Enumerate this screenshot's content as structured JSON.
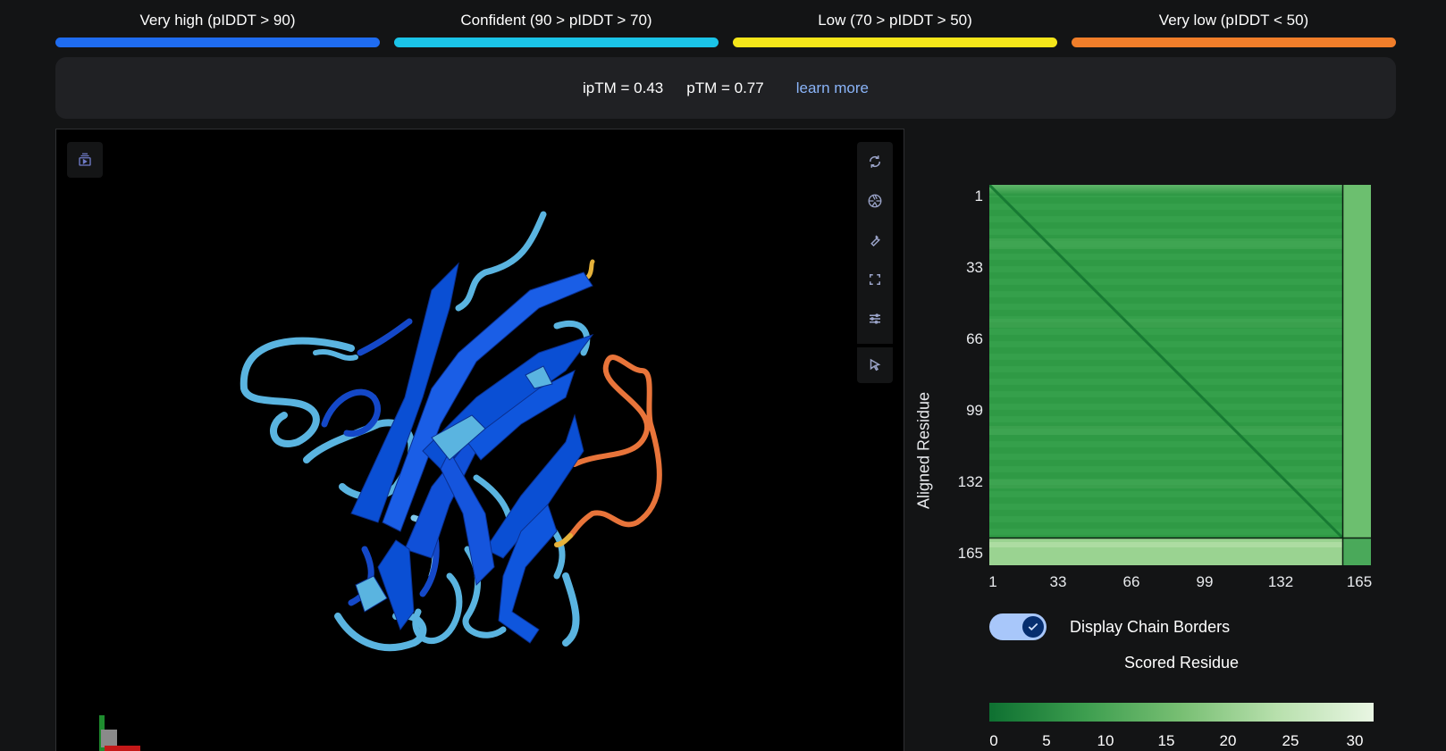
{
  "legend": [
    {
      "label": "Very high (pIDDT > 90)",
      "color": "#1f6cf0"
    },
    {
      "label": "Confident (90 > pIDDT > 70)",
      "color": "#1bc4e8"
    },
    {
      "label": "Low (70 > pIDDT > 50)",
      "color": "#f5e61a"
    },
    {
      "label": "Very low (pIDDT < 50)",
      "color": "#f07e2a"
    }
  ],
  "metrics": {
    "iptm": "ipTM = 0.43",
    "ptm": "pTM = 0.77",
    "learn_more": "learn more"
  },
  "viewer": {
    "icons": {
      "toggle": "panel-toggle-icon",
      "rotate": "rotate-icon",
      "camera": "camera-icon",
      "wrench": "wrench-icon",
      "fullscreen": "fullscreen-icon",
      "settings": "sliders-icon",
      "select": "cursor-icon"
    }
  },
  "pae": {
    "ylabel": "Aligned Residue",
    "ticks": [
      "1",
      "33",
      "66",
      "99",
      "132",
      "165"
    ],
    "display_chain_borders": "Display Chain Borders",
    "chain_borders_on": true,
    "scored_residue": "Scored Residue",
    "colorbar_ticks": [
      "0",
      "5",
      "10",
      "15",
      "20",
      "25",
      "30"
    ],
    "colors": {
      "low": "#0e7031",
      "high": "#e9f6e3"
    }
  }
}
